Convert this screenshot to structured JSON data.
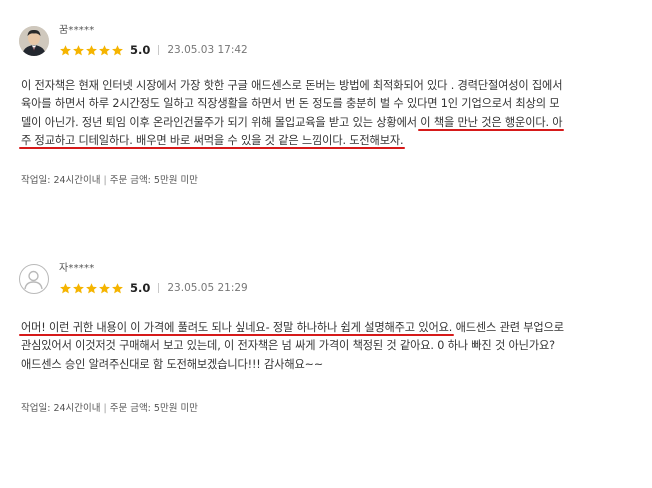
{
  "reviews": [
    {
      "user": "꿈*****",
      "rating": "5.0",
      "stars": 5,
      "date": "23.05.03 17:42",
      "lines": [
        [
          {
            "t": "이 전자책은 현재 인터넷 시장에서 가장 핫한 구글 애드센스로 돈버는 방법에 최적화되어 있다 . 경력단절여성이 집에서",
            "hl": false
          }
        ],
        [
          {
            "t": "육아를 하면서 하루 2시간정도 일하고 직장생활을 하면서 번 돈 정도를 충분히 벌 수 있다면 1인 기업으로서 최상의 모",
            "hl": false
          }
        ],
        [
          {
            "t": "델이 아닌가. 정년 퇴임 이후 온라인건물주가 되기 위해 몰입교육을 받고 있는 상황에서 ",
            "hl": false
          },
          {
            "t": "이 책을 만난 것은 행운이다. 아",
            "hl": true
          }
        ],
        [
          {
            "t": "주 정교하고 디테일하다. 배우면 바로 써먹을 수 있을 것 같은 느낌이다. 도전해보자.",
            "hl": true
          }
        ]
      ],
      "order_time": "작업일: 24시간이내",
      "order_sep": "|",
      "order_amount": "주문 금액: 5만원 미만"
    },
    {
      "user": "자*****",
      "rating": "5.0",
      "stars": 5,
      "date": "23.05.05 21:29",
      "lines": [
        [
          {
            "t": "어머! 이런 귀한 내용이 이 가격에 풀려도 되나 싶네요- 정말 하나하나 쉽게 설명해주고 있어요.",
            "hl": true
          },
          {
            "t": " 애드센스 관련 부업으로",
            "hl": false
          }
        ],
        [
          {
            "t": "관심있어서 이것저것 구매해서 보고 있는데, 이 전자책은 넘 싸게 가격이 책정된 것 같아요. 0 하나 빠진 것 아닌가요?",
            "hl": false
          }
        ],
        [
          {
            "t": "애드센스 승인 알려주신대로 함 도전해보겠습니다!!! 감사해요~~",
            "hl": false
          }
        ]
      ],
      "order_time": "작업일: 24시간이내",
      "order_sep": "|",
      "order_amount": "주문 금액: 5만원 미만"
    }
  ],
  "colors": {
    "star": "#f5b400",
    "highlight": "#d61a1a"
  },
  "icons": {
    "star": "star-icon",
    "avatar_photo": "user-photo-avatar",
    "avatar_default": "default-user-icon"
  }
}
